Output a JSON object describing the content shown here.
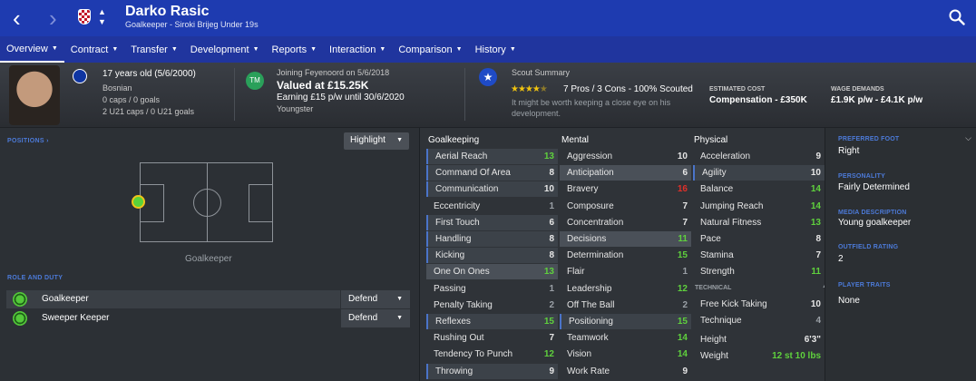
{
  "header": {
    "player_name": "Darko Rasic",
    "subtitle": "Goalkeeper - Siroki Brijeg Under 19s"
  },
  "menu": [
    {
      "label": "Overview"
    },
    {
      "label": "Contract"
    },
    {
      "label": "Transfer"
    },
    {
      "label": "Development"
    },
    {
      "label": "Reports"
    },
    {
      "label": "Interaction"
    },
    {
      "label": "Comparison"
    },
    {
      "label": "History"
    }
  ],
  "info": {
    "age": "17 years old (5/6/2000)",
    "nationality": "Bosnian",
    "caps": "0 caps / 0 goals",
    "u21_caps": "2 U21 caps / 0 U21 goals",
    "joining": "Joining Feyenoord on 5/6/2018",
    "value": "Valued at £15.25K",
    "earning": "Earning £15 p/w until 30/6/2020",
    "status": "Youngster",
    "tm_badge": "TM",
    "scout_title": "Scout Summary",
    "scout_line": "7 Pros / 3 Cons - 100% Scouted",
    "scout_note_1": "It might be worth keeping a close eye on his",
    "scout_note_2": "development.",
    "star_rating": 4.5,
    "est_cost_label": "ESTIMATED COST",
    "est_cost": "Compensation - £350K",
    "wage_label": "WAGE DEMANDS",
    "wage": "£1.9K p/w - £4.1K p/w"
  },
  "left": {
    "positions_label": "POSITIONS",
    "positions_arrow": "›",
    "highlight": "Highlight",
    "pitch_caption": "Goalkeeper",
    "role_label": "ROLE AND DUTY",
    "roles": [
      {
        "name": "Goalkeeper",
        "duty": "Defend"
      },
      {
        "name": "Sweeper Keeper",
        "duty": "Defend"
      }
    ]
  },
  "columns": {
    "goalkeeping": "Goalkeeping",
    "mental": "Mental",
    "physical": "Physical",
    "technical": "TECHNICAL"
  },
  "goalkeeping": [
    {
      "name": "Aerial Reach",
      "value": "13"
    },
    {
      "name": "Command Of Area",
      "value": "8"
    },
    {
      "name": "Communication",
      "value": "10"
    },
    {
      "name": "Eccentricity",
      "value": "1"
    },
    {
      "name": "First Touch",
      "value": "6"
    },
    {
      "name": "Handling",
      "value": "8"
    },
    {
      "name": "Kicking",
      "value": "8"
    },
    {
      "name": "One On Ones",
      "value": "13"
    },
    {
      "name": "Passing",
      "value": "1"
    },
    {
      "name": "Penalty Taking",
      "value": "2"
    },
    {
      "name": "Reflexes",
      "value": "15"
    },
    {
      "name": "Rushing Out",
      "value": "7"
    },
    {
      "name": "Tendency To Punch",
      "value": "12"
    },
    {
      "name": "Throwing",
      "value": "9"
    }
  ],
  "mental": [
    {
      "name": "Aggression",
      "value": "10"
    },
    {
      "name": "Anticipation",
      "value": "6"
    },
    {
      "name": "Bravery",
      "value": "16"
    },
    {
      "name": "Composure",
      "value": "7"
    },
    {
      "name": "Concentration",
      "value": "7"
    },
    {
      "name": "Decisions",
      "value": "11"
    },
    {
      "name": "Determination",
      "value": "15"
    },
    {
      "name": "Flair",
      "value": "1"
    },
    {
      "name": "Leadership",
      "value": "12"
    },
    {
      "name": "Off The Ball",
      "value": "2"
    },
    {
      "name": "Positioning",
      "value": "15"
    },
    {
      "name": "Teamwork",
      "value": "14"
    },
    {
      "name": "Vision",
      "value": "14"
    },
    {
      "name": "Work Rate",
      "value": "9"
    }
  ],
  "physical": [
    {
      "name": "Acceleration",
      "value": "9"
    },
    {
      "name": "Agility",
      "value": "10"
    },
    {
      "name": "Balance",
      "value": "14"
    },
    {
      "name": "Jumping Reach",
      "value": "14"
    },
    {
      "name": "Natural Fitness",
      "value": "13"
    },
    {
      "name": "Pace",
      "value": "8"
    },
    {
      "name": "Stamina",
      "value": "7"
    },
    {
      "name": "Strength",
      "value": "11"
    }
  ],
  "technical": [
    {
      "name": "Free Kick Taking",
      "value": "10"
    },
    {
      "name": "Technique",
      "value": "4"
    }
  ],
  "body": [
    {
      "name": "Height",
      "value": "6'3\""
    },
    {
      "name": "Weight",
      "value": "12 st 10 lbs"
    }
  ],
  "right": {
    "foot_label": "PREFERRED FOOT",
    "foot": "Right",
    "personality_label": "PERSONALITY",
    "personality": "Fairly Determined",
    "media_label": "MEDIA DESCRIPTION",
    "media": "Young goalkeeper",
    "outfield_label": "OUTFIELD RATING",
    "outfield": "2",
    "traits_label": "PLAYER TRAITS",
    "traits": "None"
  },
  "colors": {
    "accent": "#1e3bb0",
    "green": "#5fd13d",
    "red": "#e0302a"
  }
}
